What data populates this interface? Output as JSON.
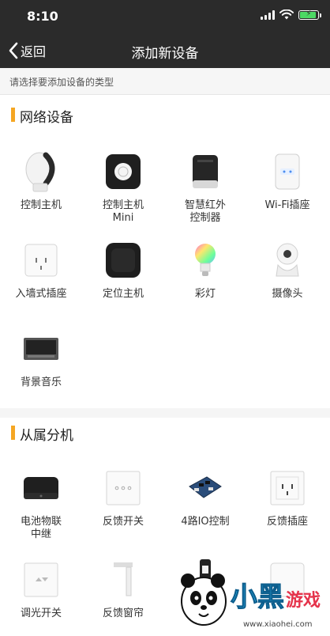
{
  "status": {
    "time": "8:10"
  },
  "nav": {
    "back_label": "返回",
    "title": "添加新设备"
  },
  "hint": "请选择要添加设备的类型",
  "sections": [
    {
      "title": "网络设备",
      "items": [
        {
          "label": "控制主机",
          "icon": "host-controller-icon"
        },
        {
          "label": "控制主机\nMini",
          "icon": "mini-controller-icon"
        },
        {
          "label": "智慧红外\n控制器",
          "icon": "ir-controller-icon"
        },
        {
          "label": "Wi-Fi插座",
          "icon": "wifi-socket-icon"
        },
        {
          "label": "入墙式插座",
          "icon": "wall-socket-icon"
        },
        {
          "label": "定位主机",
          "icon": "locator-host-icon"
        },
        {
          "label": "彩灯",
          "icon": "color-bulb-icon"
        },
        {
          "label": "摄像头",
          "icon": "camera-icon"
        },
        {
          "label": "背景音乐",
          "icon": "music-panel-icon"
        }
      ]
    },
    {
      "title": "从属分机",
      "items": [
        {
          "label": "电池物联\n中继",
          "icon": "relay-box-icon"
        },
        {
          "label": "反馈开关",
          "icon": "feedback-switch-icon"
        },
        {
          "label": "4路IO控制",
          "icon": "io-board-icon"
        },
        {
          "label": "反馈插座",
          "icon": "feedback-socket-icon"
        },
        {
          "label": "调光开关",
          "icon": "dimmer-switch-icon"
        },
        {
          "label": "反馈窗帘",
          "icon": "curtain-icon"
        },
        {
          "label": "",
          "icon": "door-lock-icon"
        },
        {
          "label": "",
          "icon": "panel-icon"
        }
      ]
    }
  ],
  "watermark": {
    "text": "小黑游戏",
    "url": "www.xiaohei.com"
  },
  "colors": {
    "topbar": "#2b2b2b",
    "accent": "#f5a623",
    "battery": "#4cd964"
  }
}
